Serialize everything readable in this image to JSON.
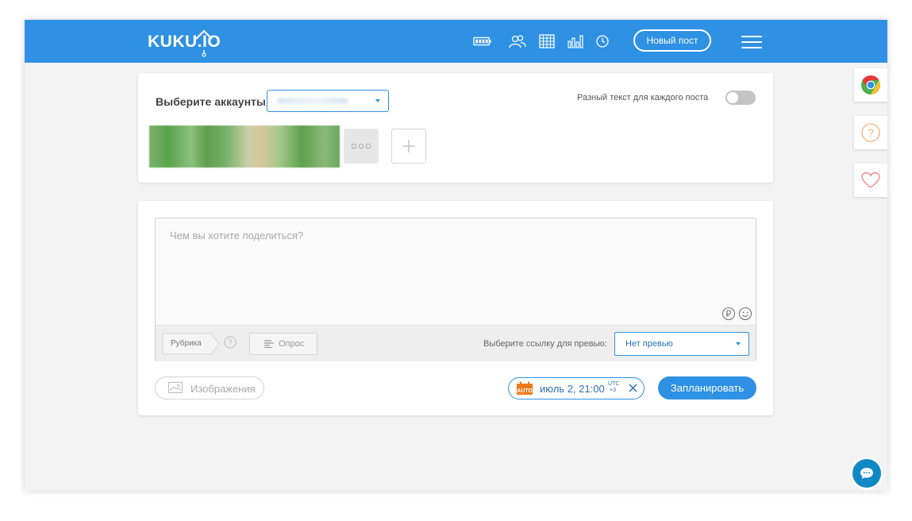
{
  "header": {
    "logo_text": "KUKU.IO",
    "new_post_label": "Новый пост",
    "nav_icons": [
      "battery-icon",
      "users-icon",
      "calendar-grid-icon",
      "stats-icon",
      "clock-icon"
    ]
  },
  "accounts": {
    "label": "Выберите аккаунты",
    "different_text_label": "Разный текст для каждого поста",
    "toggle_on": false
  },
  "editor": {
    "placeholder": "Чем вы хотите поделиться?",
    "rubric_label": "Рубрика",
    "poll_label": "Опрос",
    "preview_label": "Выберите ссылку для превью:",
    "preview_value": "Нет превью"
  },
  "footer": {
    "images_label": "Изображения",
    "auto_badge": "AUTO",
    "date_value": "июль 2, 21:00",
    "utc_label": "UTC",
    "utc_offset": "+3",
    "schedule_label": "Запланировать"
  },
  "colors": {
    "accent": "#2f91e3",
    "header_bg": "#2f91e3",
    "page_bg": "#f3f3f3",
    "auto_badge": "#f07a1a",
    "heart": "#f08a8a",
    "help": "#f5b27a"
  }
}
